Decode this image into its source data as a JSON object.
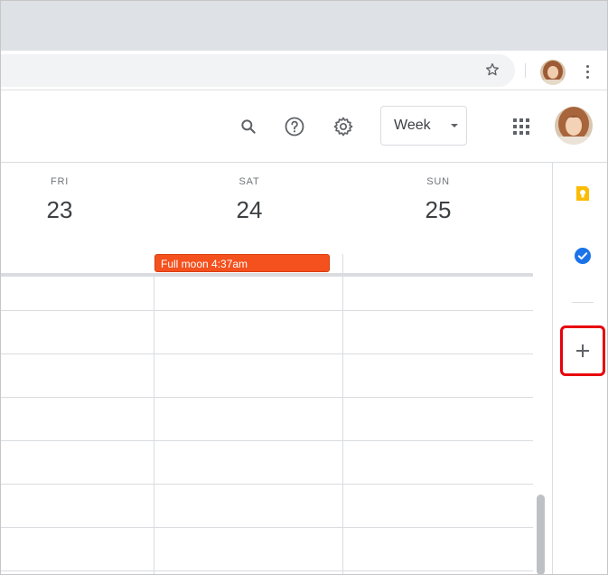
{
  "browser": {
    "icons": [
      "star-icon",
      "browser-avatar",
      "browser-menu-icon"
    ]
  },
  "header": {
    "view_select": "Week",
    "icons": [
      "search-icon",
      "help-icon",
      "settings-icon",
      "apps-icon",
      "account-avatar"
    ]
  },
  "days": [
    {
      "name": "FRI",
      "number": "23"
    },
    {
      "name": "SAT",
      "number": "24"
    },
    {
      "name": "SUN",
      "number": "25"
    }
  ],
  "events": [
    {
      "title": "Full moon 4:37am",
      "day": "SAT",
      "color": "#f4511e"
    }
  ],
  "side_panel": {
    "icons": [
      "keep-icon",
      "tasks-icon",
      "add-addon-icon"
    ],
    "highlight_color": "#e8000b"
  },
  "colors": {
    "event": "#f4511e",
    "grid_line": "#dadce0",
    "keep": "#fbbc04",
    "tasks": "#1a73e8"
  }
}
